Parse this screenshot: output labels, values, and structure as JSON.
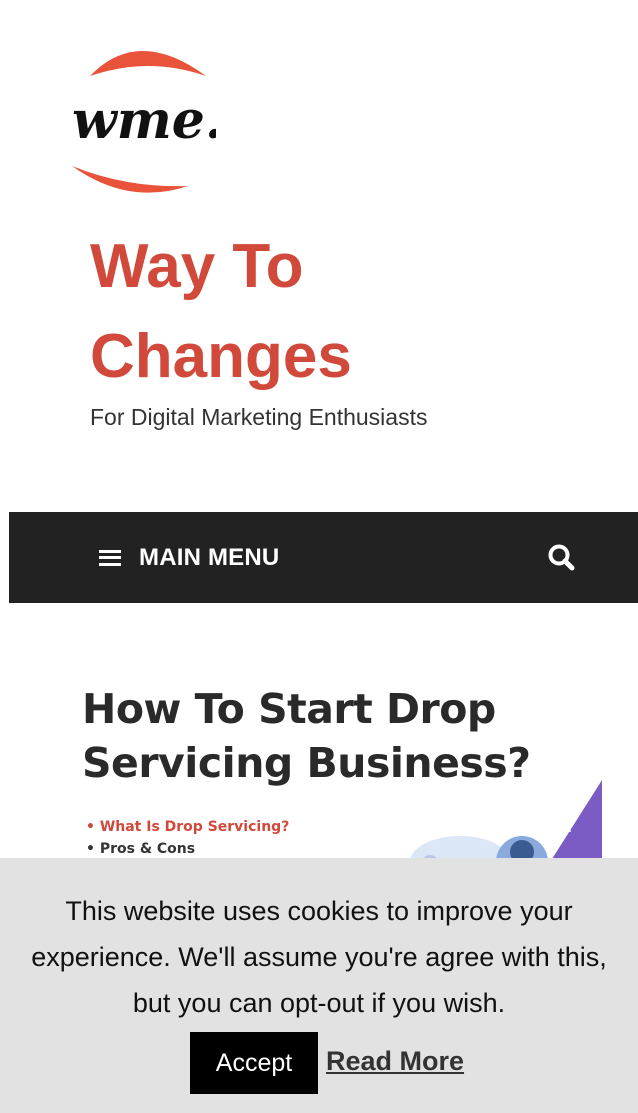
{
  "header": {
    "logo_text": "wтe.",
    "site_title_line1": "Way To",
    "site_title_line2": "Changes",
    "tagline": "For Digital Marketing Enthusiasts",
    "brand_color": "#d1493a"
  },
  "navbar": {
    "menu_label": "MAIN MENU",
    "menu_icon": "hamburger-icon",
    "search_icon": "search-icon",
    "background": "#222222"
  },
  "featured": {
    "title_line1": "How To Start Drop",
    "title_line2": "Servicing Business?",
    "bullets": [
      "• What Is Drop Servicing?",
      "• Pros & Cons"
    ]
  },
  "cookie": {
    "message": "This website uses cookies to improve your experience. We'll assume you're agree with this, but you can opt-out if you wish.",
    "accept_label": "Accept",
    "read_more_label": "Read More"
  }
}
